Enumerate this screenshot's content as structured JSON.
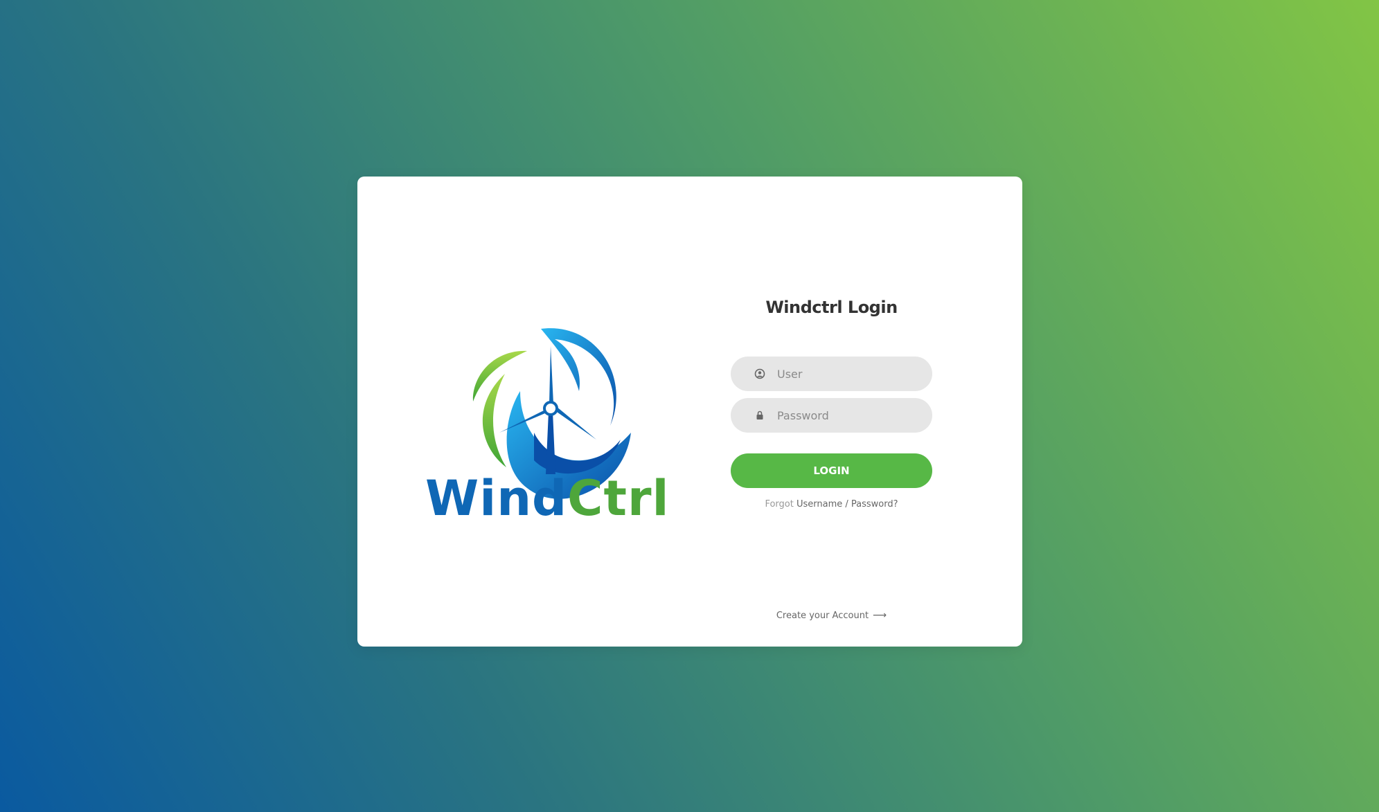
{
  "logo": {
    "wordmark_part1": "Wind",
    "wordmark_part2": "Ctrl",
    "icon": "wind-turbine-logo-icon"
  },
  "login": {
    "title": "Windctrl Login",
    "user_placeholder": "User",
    "user_value": "",
    "user_icon": "user-icon",
    "password_placeholder": "Password",
    "password_value": "",
    "password_icon": "lock-icon",
    "login_label": "LOGIN",
    "forgot_prefix": "Forgot",
    "forgot_link": "Username / Password?",
    "create_account": "Create your Account",
    "create_arrow": "⟶"
  },
  "colors": {
    "primary_button": "#57b846",
    "background_start": "#0a5aa0",
    "background_end": "#82c545",
    "input_bg": "#e6e6e6"
  }
}
